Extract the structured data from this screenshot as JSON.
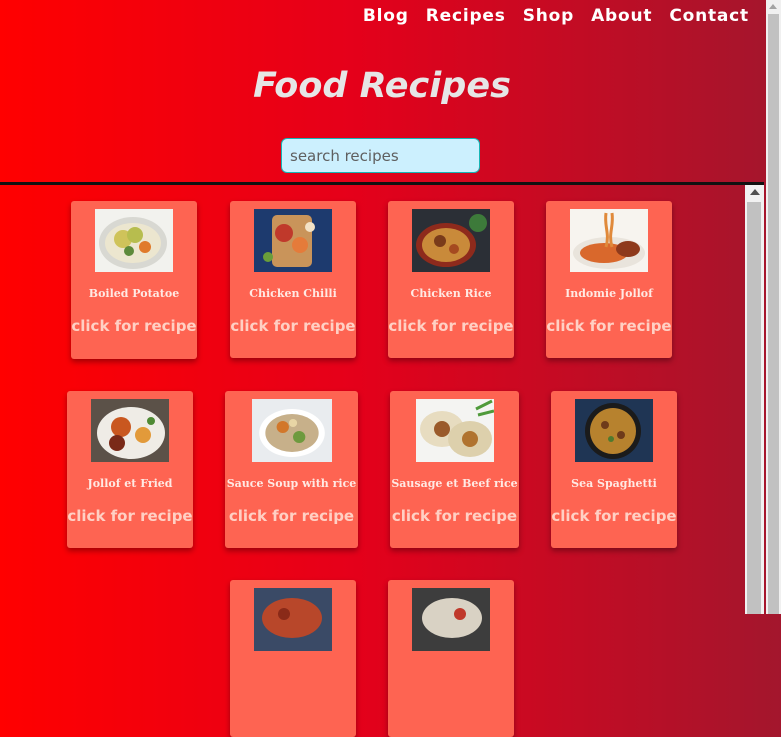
{
  "nav": [
    "Blog",
    "Recipes",
    "Shop",
    "About",
    "Contact"
  ],
  "title": "Food Recipes",
  "search": {
    "placeholder": "search recipes"
  },
  "cta_label": "click for recipe",
  "recipes": [
    {
      "name": "Boiled Potatoe",
      "image": "potatoes-plate"
    },
    {
      "name": "Chicken Chilli",
      "image": "chicken-chilli-board"
    },
    {
      "name": "Chicken Rice",
      "image": "chicken-rice-pan"
    },
    {
      "name": "Indomie Jollof",
      "image": "noodles-fork"
    },
    {
      "name": "Jollof et Fried",
      "image": "jollof-plate"
    },
    {
      "name": "Sauce Soup with rice",
      "image": "sauce-soup-bowl"
    },
    {
      "name": "Sausage et Beef rice",
      "image": "sausage-beef-rice"
    },
    {
      "name": "Sea Spaghetti",
      "image": "spaghetti-pan"
    },
    {
      "name": "",
      "image": "partial-dish-1"
    },
    {
      "name": "",
      "image": "partial-dish-2"
    }
  ],
  "colors": {
    "background_start": "#ff0000",
    "background_end": "#a3162d",
    "card": "#fe6452",
    "search_bg": "#ccf0fe"
  }
}
